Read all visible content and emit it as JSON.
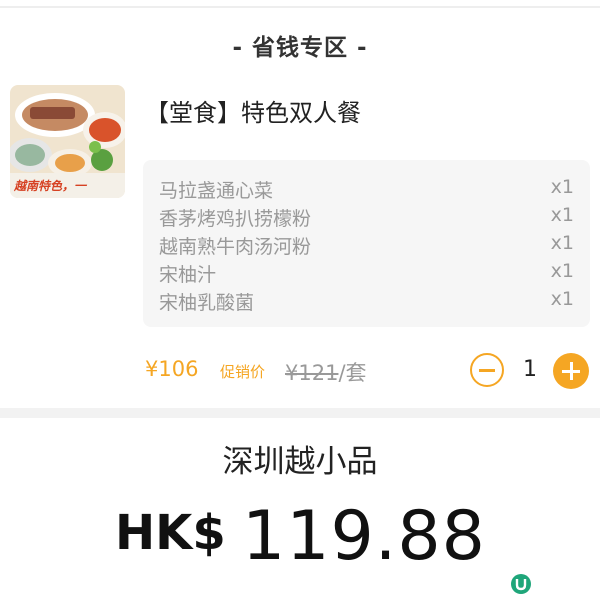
{
  "section": {
    "title": "- 省钱专区 -"
  },
  "deal": {
    "name": "【堂食】特色双人餐",
    "image_caption": "越南特色，一",
    "items": [
      {
        "name": "马拉盏通心菜",
        "qty": "x1"
      },
      {
        "name": "香茅烤鸡扒捞檬粉",
        "qty": "x1"
      },
      {
        "name": "越南熟牛肉汤河粉",
        "qty": "x1"
      },
      {
        "name": "宋柚汁",
        "qty": "x1"
      },
      {
        "name": "宋柚乳酸菌",
        "qty": "x1"
      }
    ],
    "sale_price": "¥106",
    "promo_label": "促销价",
    "original_price": "¥121",
    "unit": "/套",
    "quantity": "1"
  },
  "restaurant": {
    "name": "深圳越小品"
  },
  "total": {
    "currency": "HK$",
    "amount": "119.88"
  },
  "colors": {
    "accent": "#f5a623",
    "muted_text": "#999999",
    "box_bg": "#f6f6f6"
  },
  "icons": {
    "minus": "minus-circle-icon",
    "plus": "plus-circle-icon",
    "watermark": "u-logo-icon"
  }
}
